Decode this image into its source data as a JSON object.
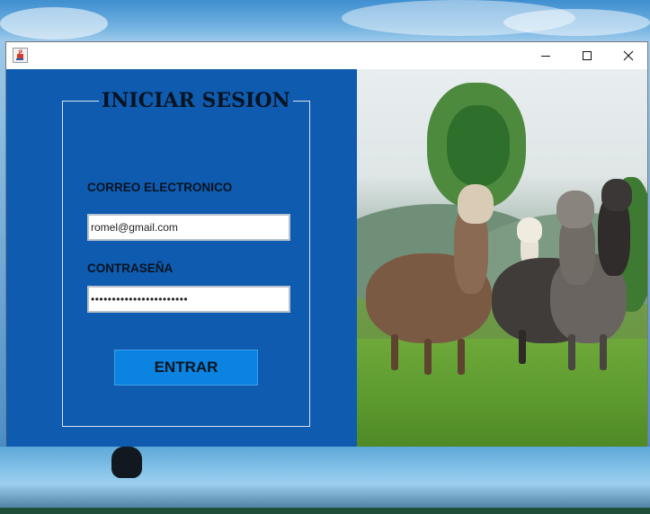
{
  "window": {
    "title": "",
    "controls": {
      "minimize": "—",
      "maximize": "☐",
      "close": "✕"
    },
    "app_icon": "java-cup-icon"
  },
  "login": {
    "heading": "INICIAR SESION",
    "email_label": "CORREO ELECTRONICO",
    "email_value": "romel@gmail.com",
    "password_label": "CONTRASEÑA",
    "password_value": "•••••••••••••••••••••••",
    "submit_label": "ENTRAR"
  },
  "image": {
    "subject": "alpacas in green field"
  },
  "colors": {
    "panel_blue": "#0e5bb0",
    "button_blue": "#0a84e0",
    "text_dark": "#0a1320"
  }
}
